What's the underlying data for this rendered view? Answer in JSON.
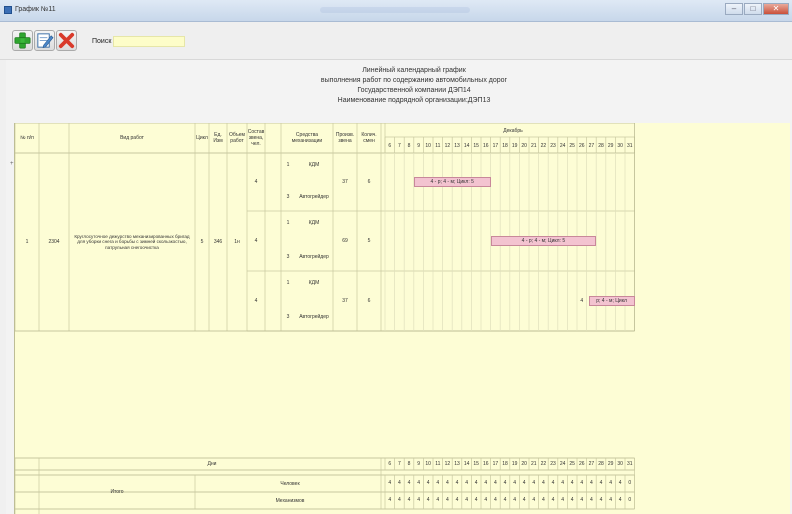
{
  "window": {
    "title": "График №11"
  },
  "toolbar": {
    "add_icon": "plus-icon",
    "edit_icon": "edit-icon",
    "delete_icon": "delete-icon",
    "search_label": "Поиск",
    "search_value": ""
  },
  "heading": {
    "line1": "Линейный календарный график",
    "line2": "выполнения работ по содержанию автомобильных дорог",
    "line3": "Государственной компании ДЭП14",
    "line4": "Наименование подрядной организации:ДЭП13"
  },
  "table": {
    "columns": {
      "num": "№ п/п",
      "kind": "Вид работ",
      "cycle": "Цикл",
      "unit": "Ед. Изм",
      "volume": "Объем работ",
      "crew": "Состав звена, чел.",
      "machines": "Средства механизации",
      "output": "Произв. звена",
      "shifts": "Колич. смен"
    },
    "month": "Декабрь",
    "days": [
      "6",
      "7",
      "8",
      "9",
      "10",
      "11",
      "12",
      "13",
      "14",
      "15",
      "16",
      "17",
      "18",
      "19",
      "20",
      "21",
      "22",
      "23",
      "24",
      "25",
      "26",
      "27",
      "28",
      "29",
      "30",
      "31"
    ],
    "row": {
      "num": "1",
      "code": "2304",
      "kind": "Круглосуточное дежурство механизированных бригад для уборки снега и борьбы с зимней скользкостью, патрульная снегоочистка",
      "cycle": "5",
      "unit": "346",
      "volume": "1н",
      "expand_mark": "+"
    },
    "groups": [
      {
        "crew": "4",
        "m1_num": "1",
        "m1_name": "КДМ",
        "m2_num": "3",
        "m2_name": "Автогрейдер",
        "output": "37",
        "shifts": "6",
        "bar": "4 - р; 4 - м; Цикл: 5"
      },
      {
        "crew": "4",
        "m1_num": "1",
        "m1_name": "КДМ",
        "m2_num": "3",
        "m2_name": "Автогрейдер",
        "output": "69",
        "shifts": "5",
        "bar": "4 - р; 4 - м; Цикл: 5"
      },
      {
        "crew": "4",
        "m1_num": "1",
        "m1_name": "КДМ",
        "m2_num": "3",
        "m2_name": "Автогрейдер",
        "output": "37",
        "shifts": "6",
        "bar_prefix": "4",
        "bar": "р; 4 - м; Цикл"
      }
    ],
    "footer": {
      "days_label": "Дни",
      "total_label": "Итого",
      "people_label": "Человек",
      "machines_label": "Механизмов",
      "people": [
        "4",
        "4",
        "4",
        "4",
        "4",
        "4",
        "4",
        "4",
        "4",
        "4",
        "4",
        "4",
        "4",
        "4",
        "4",
        "4",
        "4",
        "4",
        "4",
        "4",
        "4",
        "4",
        "4",
        "4",
        "4",
        "0"
      ],
      "machines": [
        "4",
        "4",
        "4",
        "4",
        "4",
        "4",
        "4",
        "4",
        "4",
        "4",
        "4",
        "4",
        "4",
        "4",
        "4",
        "4",
        "4",
        "4",
        "4",
        "4",
        "4",
        "4",
        "4",
        "4",
        "4",
        "0"
      ]
    }
  },
  "colors": {
    "sheet": "#fdfdd5",
    "bar": "#f3c3d0",
    "search": "#fdfdc9"
  }
}
